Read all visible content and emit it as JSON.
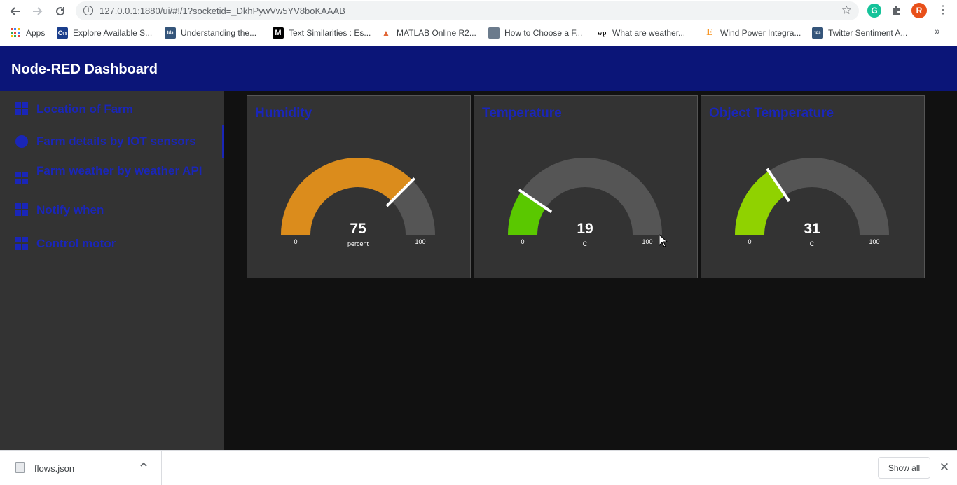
{
  "browser": {
    "url": "127.0.0.1:1880/ui/#!/1?socketid=_DkhPywVw5YV8boKAAAB",
    "profile_initial": "R",
    "bookmarks": [
      {
        "label": "Apps",
        "icon": "apps-grid-icon",
        "color": "#4285f4",
        "glyph": ""
      },
      {
        "label": "Explore Available S...",
        "icon": "on-logo-icon",
        "color": "#1a3e8c",
        "glyph": "On"
      },
      {
        "label": "Understanding the...",
        "icon": "tds-logo-icon",
        "color": "#35557a",
        "glyph": "tds"
      },
      {
        "label": "Text Similarities : Es...",
        "icon": "medium-logo-icon",
        "color": "#000000",
        "glyph": "M"
      },
      {
        "label": "MATLAB Online R2...",
        "icon": "matlab-logo-icon",
        "color": "#e16737",
        "glyph": "▲"
      },
      {
        "label": "How to Choose a F...",
        "icon": "thumbnail-icon",
        "color": "#6b7b8c",
        "glyph": ""
      },
      {
        "label": "What are weather...",
        "icon": "wp-logo-icon",
        "color": "#ffffff",
        "glyph": "wp"
      },
      {
        "label": "Wind Power Integra...",
        "icon": "e-logo-icon",
        "color": "#ffffff",
        "glyph": "E"
      },
      {
        "label": "Twitter Sentiment A...",
        "icon": "tds-logo-icon",
        "color": "#35557a",
        "glyph": "tds"
      }
    ]
  },
  "dashboard": {
    "title": "Node-RED Dashboard",
    "nav": [
      {
        "label": "Location of Farm",
        "icon": "dashboard-grid-icon",
        "active": false
      },
      {
        "label": "Farm details by IOT sensors",
        "icon": "globe-icon",
        "active": true
      },
      {
        "label": "Farm weather by weather API",
        "icon": "dashboard-grid-icon",
        "active": false
      },
      {
        "label": "Notify when",
        "icon": "dashboard-grid-icon",
        "active": false
      },
      {
        "label": "Control motor",
        "icon": "dashboard-grid-icon",
        "active": false
      }
    ],
    "gauges": [
      {
        "title": "Humidity",
        "value": 75,
        "value_label": "75",
        "unit": "percent",
        "min": 0,
        "max": 100,
        "min_label": "0",
        "max_label": "100",
        "color": "#db8c1c"
      },
      {
        "title": "Temperature",
        "value": 19,
        "value_label": "19",
        "unit": "C",
        "min": 0,
        "max": 100,
        "min_label": "0",
        "max_label": "100",
        "color": "#5ac800"
      },
      {
        "title": "Object Temperature",
        "value": 31,
        "value_label": "31",
        "unit": "C",
        "min": 0,
        "max": 100,
        "min_label": "0",
        "max_label": "100",
        "color": "#90d200"
      }
    ],
    "colors": {
      "header": "#0b1578",
      "accent": "#1a26b8",
      "sidebar": "#333333",
      "background": "#111111",
      "gauge_track": "#555555"
    }
  },
  "downloads": {
    "file_name": "flows.json",
    "show_all_label": "Show all"
  }
}
